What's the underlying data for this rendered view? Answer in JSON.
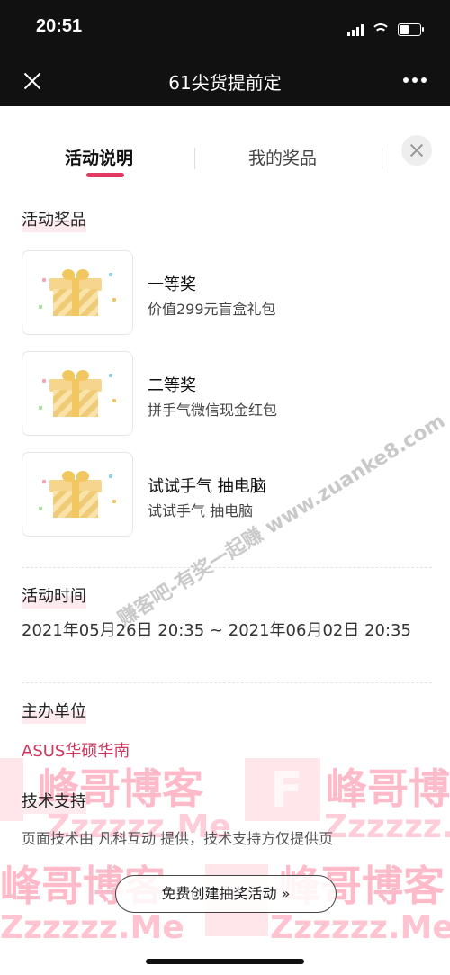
{
  "status": {
    "time": "20:51"
  },
  "nav": {
    "title": "61尖货提前定",
    "close_icon": "close-icon",
    "more_icon": "more-icon"
  },
  "tabs": {
    "active": "活动说明",
    "inactive": "我的奖品"
  },
  "sections": {
    "prizes_title": "活动奖品",
    "time_title": "活动时间",
    "org_title": "主办单位",
    "tech_title": "技术支持"
  },
  "prizes": [
    {
      "name": "一等奖",
      "desc": "价值299元盲盒礼包"
    },
    {
      "name": "二等奖",
      "desc": "拼手气微信现金红包"
    },
    {
      "name": "试试手气 抽电脑",
      "desc": "试试手气 抽电脑"
    }
  ],
  "activity_time": "2021年05月26日 20:35 ~ 2021年06月02日 20:35",
  "organizer": "ASUS华硕华南",
  "tech_support": "页面技术由 凡科互动 提供，技术支持方仅提供页",
  "cta": "免费创建抽奖活动 »",
  "watermarks": {
    "diagonal": "赚客吧-有奖一起赚 www.zuanke8.com",
    "brand": "峰哥博客",
    "site": "Zzzzzz.Me",
    "letter": "F"
  },
  "colors": {
    "accent": "#e33a63",
    "organizer": "#d0365f",
    "nav_bg": "#111111"
  }
}
